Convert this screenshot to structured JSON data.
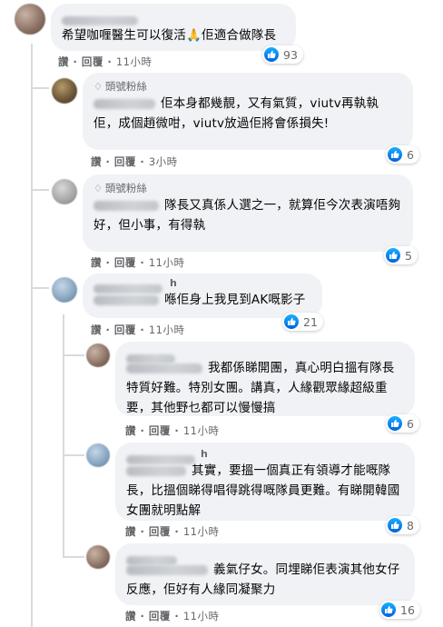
{
  "action_labels": {
    "like": "讚",
    "reply": "回覆",
    "sep": "·"
  },
  "badge_label": "頭號粉絲",
  "comments": [
    {
      "text": "希望咖喱醫生可以復活🙏佢適合做隊長",
      "time": "11小時",
      "reactions": "93"
    },
    {
      "text": "佢本身都幾靚，又有氣質，viutv再執執佢，成個趙微咁，viutv放過佢將會係損失!",
      "time": "3小時",
      "reactions": "6"
    },
    {
      "text": "隊長又真係人選之一，就算佢今次表演唔夠好，但小事，有得執",
      "time": "11小時",
      "reactions": "5"
    },
    {
      "name_tail": "h",
      "text": "喺佢身上我見到AK嘅影子",
      "time": "11小時",
      "reactions": "21"
    },
    {
      "text": "我都係睇開團，真心明白搵有隊長特質好難。特別女團。講真，人緣觀眾緣超級重要，其他野乜都可以慢慢搞",
      "time": "11小時",
      "reactions": "6"
    },
    {
      "name_tail": "h",
      "text": "其實，要搵一個真正有領導才能嘅隊長，比搵個睇得唱得跳得嘅隊員更難。有睇開韓國女團就明點解",
      "time": "11小時",
      "reactions": "8"
    },
    {
      "text": "義氣仔女。同埋睇佢表演其他女仔反應，佢好有人緣同凝聚力",
      "time": "11小時",
      "reactions": "16"
    }
  ],
  "colors": {
    "bubble": "#f0f2f5",
    "meta": "#65676b",
    "like_blue": "#0a7cff"
  },
  "icons": {
    "badge": "diamond-icon",
    "reaction": "like-thumb-icon"
  }
}
